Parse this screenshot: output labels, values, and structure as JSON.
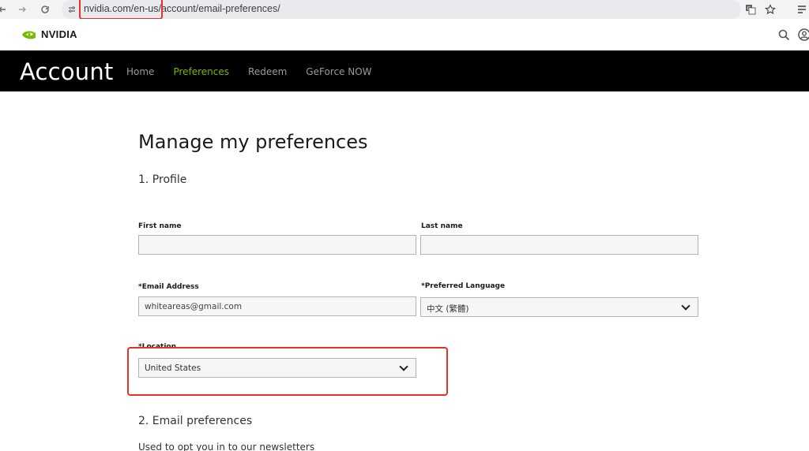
{
  "browser": {
    "url": "nvidia.com/en-us/account/email-preferences/",
    "icons": [
      "back-icon",
      "forward-icon",
      "reload-icon",
      "site-settings-icon",
      "translate-icon",
      "star-icon",
      "menu-icon"
    ]
  },
  "brand": {
    "logo_text": "NVIDIA",
    "icons": [
      "search-icon",
      "account-icon"
    ],
    "accent_color": "#76b900"
  },
  "account": {
    "title": "Account",
    "tabs": [
      {
        "label": "Home",
        "active": false
      },
      {
        "label": "Preferences",
        "active": true
      },
      {
        "label": "Redeem",
        "active": false
      },
      {
        "label": "GeForce NOW",
        "active": false
      }
    ]
  },
  "main": {
    "page_title": "Manage my preferences",
    "section_profile": "1. Profile",
    "first_name": {
      "label": "First name",
      "value": ""
    },
    "last_name": {
      "label": "Last name",
      "value": ""
    },
    "email": {
      "label": "*Email Address",
      "value": "whiteareas@gmail.com"
    },
    "language": {
      "label": "*Preferred Language",
      "value": "中文 (繁體)"
    },
    "location": {
      "label": "*Location",
      "value": "United States"
    },
    "section_email": "2. Email preferences",
    "email_help": "Used to opt you in to our newsletters"
  },
  "annotations": {
    "highlight_color": "#e8302b"
  }
}
